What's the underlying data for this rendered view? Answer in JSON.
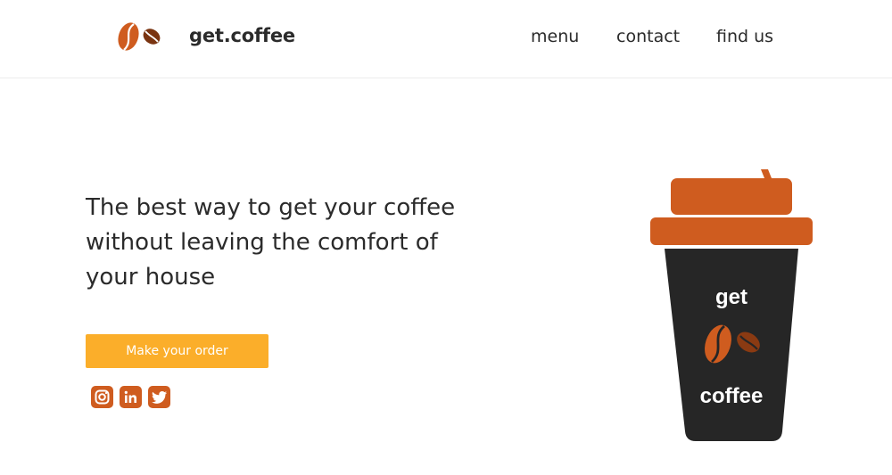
{
  "header": {
    "brand": "get.coffee",
    "logo_icon": "coffee-beans-icon",
    "nav": [
      {
        "label": "menu"
      },
      {
        "label": "contact"
      },
      {
        "label": "find us"
      }
    ]
  },
  "hero": {
    "headline": "The best way to get your coffee without leaving the comfort of your house",
    "cta_label": "Make your order",
    "social_icons": [
      "instagram-icon",
      "linkedin-icon",
      "twitter-icon"
    ]
  },
  "cup": {
    "top_text": "get",
    "bottom_text": "coffee"
  },
  "colors": {
    "accent_orange": "#cf5c1f",
    "button_yellow": "#fbae2a",
    "cup_body": "#262626",
    "bean_dark": "#8a3a12"
  }
}
